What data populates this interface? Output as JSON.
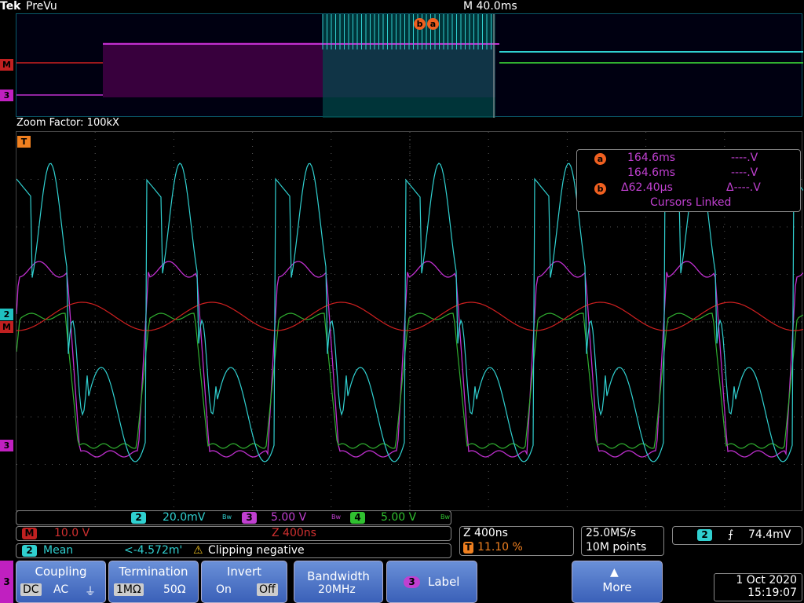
{
  "header": {
    "brand": "Tek",
    "mode": "PreVu",
    "timebase": "M 40.0ms"
  },
  "zoom": {
    "label": "Zoom Factor: 100kX"
  },
  "markers": {
    "trigger": "T",
    "math": "M",
    "ch2": "2",
    "ch3": "3"
  },
  "cursor_readout": {
    "a_label": "a",
    "b_label": "b",
    "a_time": "164.6ms",
    "b_time": "164.6ms",
    "a_volt": "----.V",
    "b_volt": "----.V",
    "delta_time": "Δ62.40μs",
    "delta_volt": "Δ----.V",
    "linked": "Cursors Linked"
  },
  "channels": {
    "ch2": {
      "num": "2",
      "scale": "20.0mV",
      "bw": "Bw",
      "color": "#30d0d0"
    },
    "ch3": {
      "num": "3",
      "scale": "5.00 V",
      "bw": "Bw",
      "color": "#c040d0"
    },
    "ch4": {
      "num": "4",
      "scale": "5.00 V",
      "bw": "Bw",
      "color": "#30c030"
    }
  },
  "math": {
    "badge": "M",
    "scale": "10.0 V",
    "zoom": "Z 400ns"
  },
  "measurement": {
    "ch": "2",
    "name": "Mean",
    "value": "<-4.572m'",
    "warning": "Clipping negative",
    "warning_icon": "warning-triangle"
  },
  "zoom_info": {
    "zoom": "Z 400ns",
    "trig_pos": "11.10 %",
    "trig_badge": "T"
  },
  "acq": {
    "rate": "25.0MS/s",
    "points": "10M points"
  },
  "trigger": {
    "ch": "2",
    "level": "74.4mV",
    "slope_icon": "rising-edge"
  },
  "menu": {
    "channel": "3",
    "coupling": {
      "title": "Coupling",
      "dc": "DC",
      "ac": "AC",
      "gnd": "⏚"
    },
    "termination": {
      "title": "Termination",
      "a": "1MΩ",
      "b": "50Ω"
    },
    "invert": {
      "title": "Invert",
      "on": "On",
      "off": "Off"
    },
    "bandwidth": {
      "title": "Bandwidth",
      "value": "20MHz"
    },
    "label": {
      "ch": "3",
      "title": "Label"
    },
    "more": {
      "title": "More"
    }
  },
  "datetime": {
    "date": "1 Oct  2020",
    "time": "15:19:07"
  }
}
